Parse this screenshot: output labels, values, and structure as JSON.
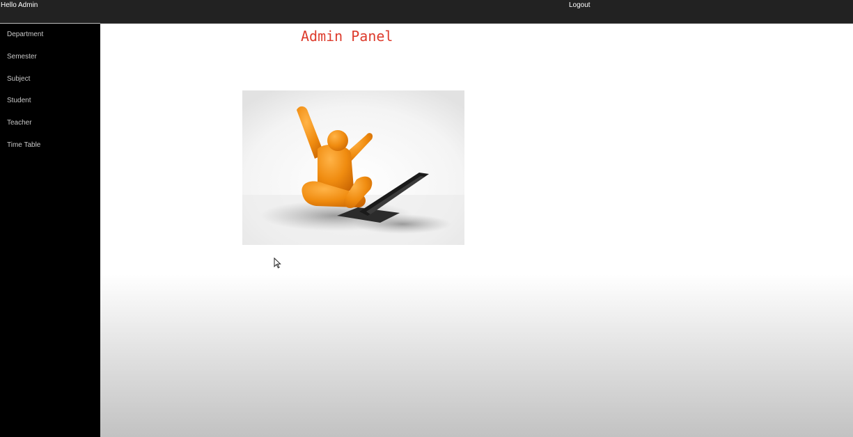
{
  "header": {
    "greeting": "Hello Admin",
    "logout_label": "Logout"
  },
  "sidebar": {
    "items": [
      {
        "label": "Department"
      },
      {
        "label": "Semester"
      },
      {
        "label": "Subject"
      },
      {
        "label": "Student"
      },
      {
        "label": "Teacher"
      },
      {
        "label": "Time Table"
      }
    ]
  },
  "main": {
    "title": "Admin Panel",
    "hero_image": "celebrating-figure-with-laptop"
  },
  "colors": {
    "header_bg": "#222222",
    "sidebar_bg": "#000000",
    "title": "#dd3b2c",
    "figure": "#f08c10"
  }
}
